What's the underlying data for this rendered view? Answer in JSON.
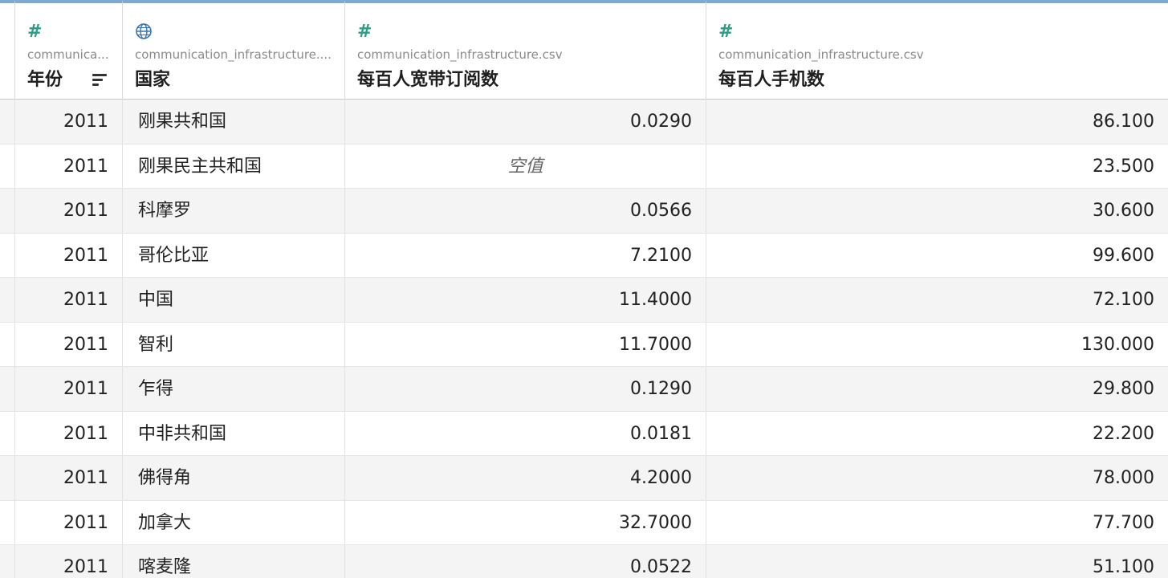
{
  "columns": [
    {
      "icon": "number-icon",
      "glyph": "#",
      "source": "communica...",
      "name": "年份"
    },
    {
      "icon": "globe-icon",
      "glyph": "🌐",
      "source": "communication_infrastructure....",
      "name": "国家"
    },
    {
      "icon": "number-icon",
      "glyph": "#",
      "source": "communication_infrastructure.csv",
      "name": "每百人宽带订阅数"
    },
    {
      "icon": "number-icon",
      "glyph": "#",
      "source": "communication_infrastructure.csv",
      "name": "每百人手机数"
    }
  ],
  "rows": [
    {
      "year": "2011",
      "country": "刚果共和国",
      "broadband": "0.0290",
      "mobile": "86.100"
    },
    {
      "year": "2011",
      "country": "刚果民主共和国",
      "broadband": "空值",
      "mobile": "23.500"
    },
    {
      "year": "2011",
      "country": "科摩罗",
      "broadband": "0.0566",
      "mobile": "30.600"
    },
    {
      "year": "2011",
      "country": "哥伦比亚",
      "broadband": "7.2100",
      "mobile": "99.600"
    },
    {
      "year": "2011",
      "country": "中国",
      "broadband": "11.4000",
      "mobile": "72.100"
    },
    {
      "year": "2011",
      "country": "智利",
      "broadband": "11.7000",
      "mobile": "130.000"
    },
    {
      "year": "2011",
      "country": "乍得",
      "broadband": "0.1290",
      "mobile": "29.800"
    },
    {
      "year": "2011",
      "country": "中非共和国",
      "broadband": "0.0181",
      "mobile": "22.200"
    },
    {
      "year": "2011",
      "country": "佛得角",
      "broadband": "4.2000",
      "mobile": "78.000"
    },
    {
      "year": "2011",
      "country": "加拿大",
      "broadband": "32.7000",
      "mobile": "77.700"
    },
    {
      "year": "2011",
      "country": "喀麦隆",
      "broadband": "0.0522",
      "mobile": "51.100"
    }
  ],
  "null_label": "空值",
  "colors": {
    "header_accent": "#7fa9cf",
    "number_icon": "#2f9c86",
    "globe_icon": "#3a77b0"
  }
}
